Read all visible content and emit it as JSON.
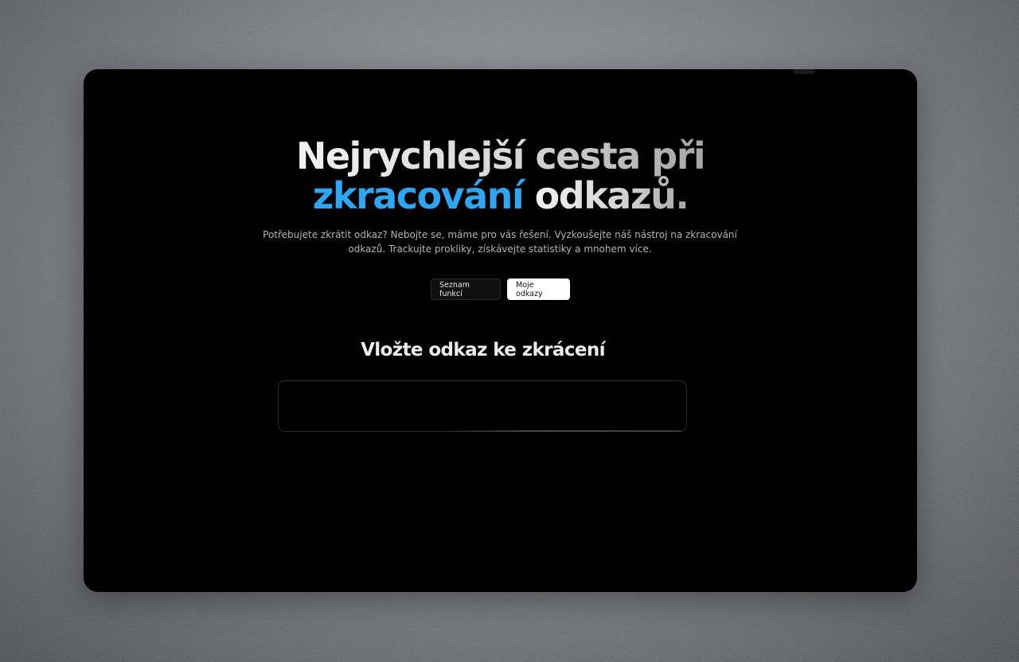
{
  "hero": {
    "title_line1": "Nejrychlejší cesta při",
    "title_accent": "zkracování",
    "title_rest": "odkazů.",
    "subtitle": "Potřebujete zkrátit odkaz? Nebojte se, máme pro vás řešení. Vyzkoušejte náš nástroj na zkracování odkazů. Trackujte prokliky, získávejte statistiky a mnohem více."
  },
  "buttons": {
    "features_label": "Seznam funkcí",
    "my_links_label": "Moje odkazy"
  },
  "shortener": {
    "heading": "Vložte odkaz ke zkrácení",
    "input_value": "",
    "input_placeholder": ""
  },
  "colors": {
    "accent": "#2ea6f2",
    "card_background": "#000000",
    "page_background": "#8a8b8f"
  }
}
